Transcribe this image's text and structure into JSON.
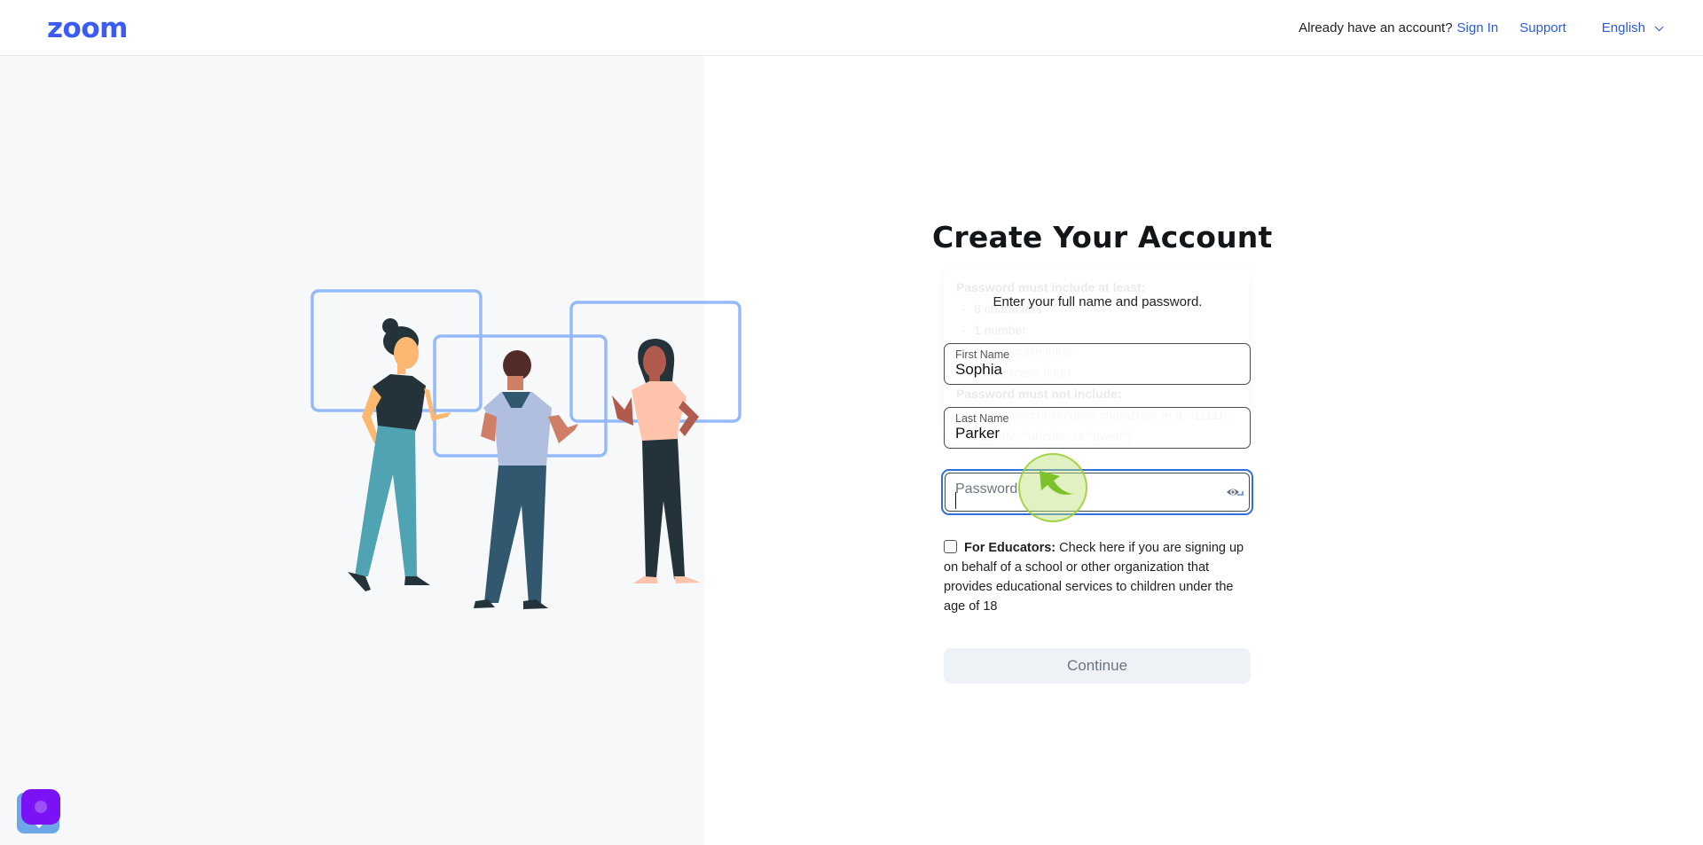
{
  "header": {
    "logo_text": "zoom",
    "account_question": "Already have an account?",
    "sign_in_label": "Sign In",
    "support_label": "Support",
    "language_label": "English"
  },
  "form": {
    "title": "Create Your Account",
    "subtitle": "Enter your full name and password.",
    "first_name": {
      "label": "First Name",
      "value": "Sophia"
    },
    "last_name": {
      "label": "Last Name",
      "value": "Parker"
    },
    "password": {
      "placeholder": "Password",
      "value": ""
    },
    "educators": {
      "bold_label": "For Educators:",
      "text": " Check here if you are signing up on behalf of a school or other organization that provides educational services to children under the age of 18",
      "checked": false
    },
    "continue_label": "Continue"
  },
  "password_tooltip": {
    "must_include_heading": "Password must include at least:",
    "must_include": [
      "8 characters",
      "1 number",
      "1 uppercase letter",
      "1 lowercase letter"
    ],
    "must_not_include_heading": "Password must not include:",
    "must_not_include": [
      "5 or more consecutive characters (e.g. \"11111\", \"12345\", \"abcde\", or \"qwert\")"
    ]
  },
  "colors": {
    "brand": "#3b5bf6",
    "link": "#2b5bd7",
    "focus_ring": "#2f6fde",
    "left_panel_bg": "#f7f8fa",
    "button_disabled_bg": "#eef2f6"
  }
}
